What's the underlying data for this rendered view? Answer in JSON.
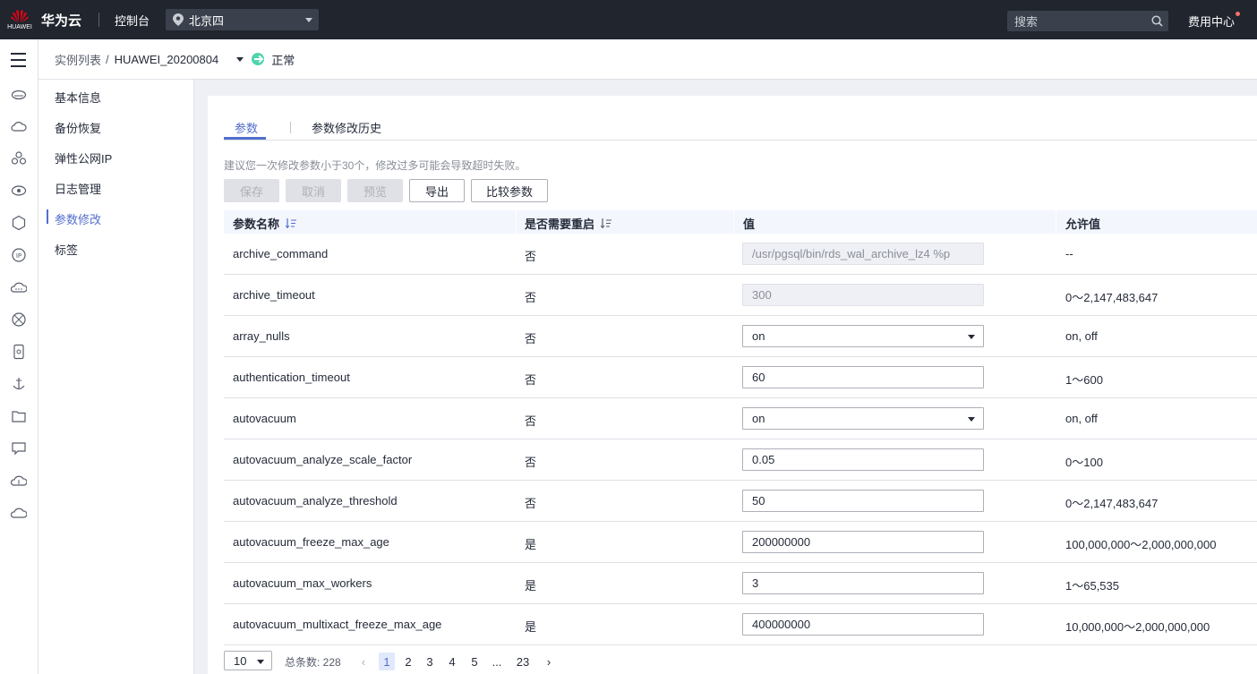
{
  "topbar": {
    "logo_word": "HUAWEI",
    "brand": "华为云",
    "console": "控制台",
    "region": "北京四",
    "search_placeholder": "搜索",
    "fee_center": "费用中心"
  },
  "breadcrumb": {
    "root": "实例列表",
    "separator": "/",
    "instance": "HUAWEI_20200804",
    "status": "正常"
  },
  "subnav": {
    "items": [
      {
        "label": "基本信息"
      },
      {
        "label": "备份恢复"
      },
      {
        "label": "弹性公网IP"
      },
      {
        "label": "日志管理"
      },
      {
        "label": "参数修改"
      },
      {
        "label": "标签"
      }
    ],
    "active_index": 4
  },
  "tabs": [
    {
      "label": "参数"
    },
    {
      "label": "参数修改历史"
    }
  ],
  "hint": "建议您一次修改参数小于30个，修改过多可能会导致超时失败。",
  "buttons": {
    "save": "保存",
    "cancel": "取消",
    "preview": "预览",
    "export": "导出",
    "compare": "比较参数"
  },
  "table": {
    "headers": {
      "name": "参数名称",
      "restart": "是否需要重启",
      "value": "值",
      "allowed": "允许值"
    },
    "rows": [
      {
        "name": "archive_command",
        "restart": "否",
        "value": "/usr/pgsql/bin/rds_wal_archive_lz4 %p",
        "allowed": "--",
        "kind": "readonly"
      },
      {
        "name": "archive_timeout",
        "restart": "否",
        "value": "300",
        "allowed": "0～2,147,483,647",
        "kind": "readonly"
      },
      {
        "name": "array_nulls",
        "restart": "否",
        "value": "on",
        "allowed": "on, off",
        "kind": "select"
      },
      {
        "name": "authentication_timeout",
        "restart": "否",
        "value": "60",
        "allowed": "1～600",
        "kind": "input"
      },
      {
        "name": "autovacuum",
        "restart": "否",
        "value": "on",
        "allowed": "on, off",
        "kind": "select"
      },
      {
        "name": "autovacuum_analyze_scale_factor",
        "restart": "否",
        "value": "0.05",
        "allowed": "0～100",
        "kind": "input"
      },
      {
        "name": "autovacuum_analyze_threshold",
        "restart": "否",
        "value": "50",
        "allowed": "0～2,147,483,647",
        "kind": "input"
      },
      {
        "name": "autovacuum_freeze_max_age",
        "restart": "是",
        "value": "200000000",
        "allowed": "100,000,000～2,000,000,000",
        "kind": "input"
      },
      {
        "name": "autovacuum_max_workers",
        "restart": "是",
        "value": "3",
        "allowed": "1～65,535",
        "kind": "input"
      },
      {
        "name": "autovacuum_multixact_freeze_max_age",
        "restart": "是",
        "value": "400000000",
        "allowed": "10,000,000～2,000,000,000",
        "kind": "input"
      }
    ]
  },
  "pagination": {
    "page_size": "10",
    "total_label": "总条数: 228",
    "pages": [
      "1",
      "2",
      "3",
      "4",
      "5",
      "...",
      "23"
    ],
    "current": "1",
    "prev": "‹",
    "next": "›"
  },
  "colors": {
    "accent": "#526ecc",
    "topbar_bg": "#20252e",
    "status_ok": "#50d4ab",
    "header_row_bg": "#f3f6fd"
  }
}
